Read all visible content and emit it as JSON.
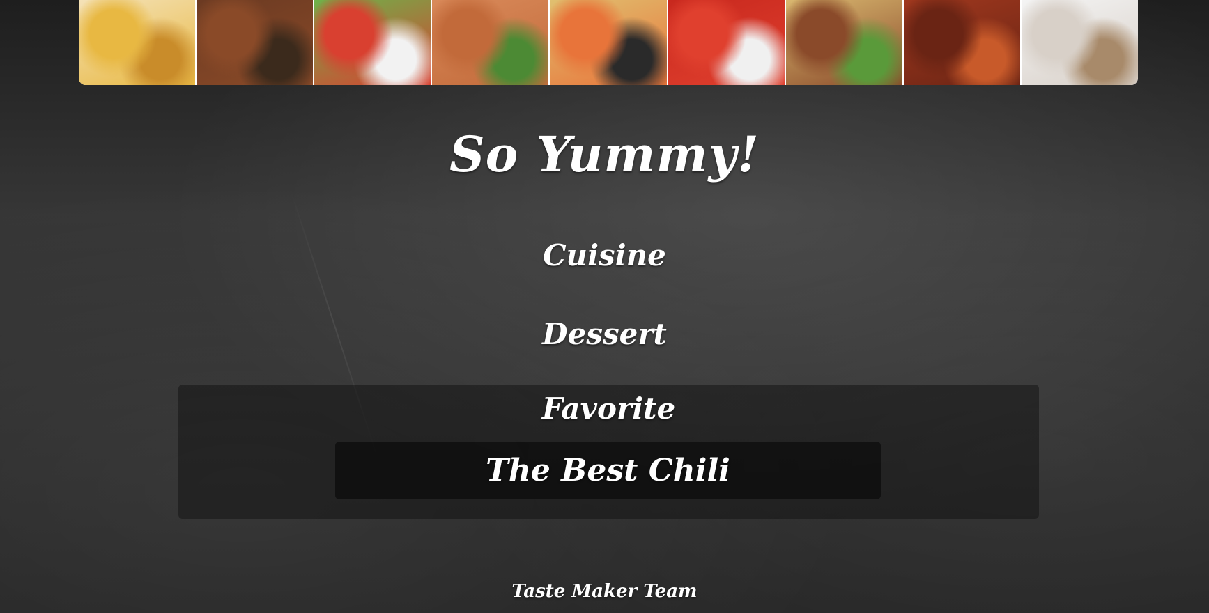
{
  "header": {
    "banner_photos": [
      {
        "name": "fries-photo",
        "colors": [
          "#f4e2b8",
          "#e8b842",
          "#c98c2a"
        ]
      },
      {
        "name": "steak-photo",
        "colors": [
          "#6b3a22",
          "#8a4a28",
          "#3b2a1c"
        ]
      },
      {
        "name": "salad-photo",
        "colors": [
          "#6db34a",
          "#d94030",
          "#f2f2f2"
        ]
      },
      {
        "name": "salmon-photo",
        "colors": [
          "#d98a5a",
          "#c26a3a",
          "#4c8a34"
        ]
      },
      {
        "name": "shrimp-pasta-photo",
        "colors": [
          "#e0c070",
          "#e8743a",
          "#2a2a2a"
        ]
      },
      {
        "name": "spaghetti-photo",
        "colors": [
          "#c8281e",
          "#e0402e",
          "#f0f0f0"
        ]
      },
      {
        "name": "burrito-photo",
        "colors": [
          "#d9b870",
          "#8a4a2a",
          "#5a9a3a"
        ]
      },
      {
        "name": "grilled-chicken-photo",
        "colors": [
          "#a0381e",
          "#6a2414",
          "#c85a2a"
        ]
      },
      {
        "name": "coffee-photo",
        "colors": [
          "#f4f4f4",
          "#d8d0c8",
          "#a88a6a"
        ]
      }
    ]
  },
  "title": "So Yummy!",
  "nav": {
    "cuisine": "Cuisine",
    "dessert": "Dessert",
    "favorite": "Favorite"
  },
  "favorites": {
    "items": [
      "The Best Chili"
    ]
  },
  "footer": {
    "text": "Taste Maker Team"
  }
}
